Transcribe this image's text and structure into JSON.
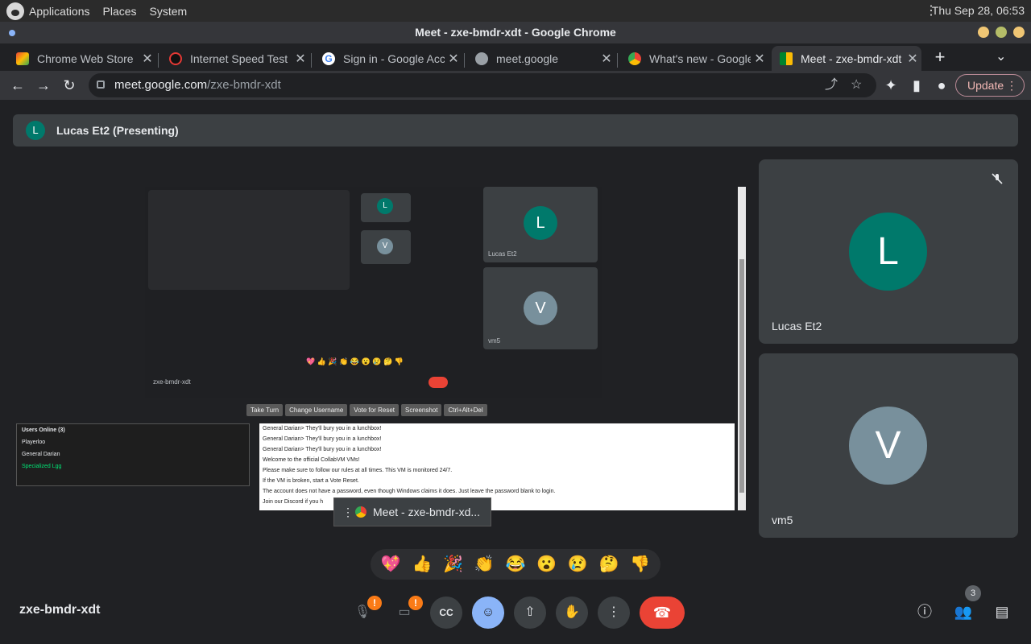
{
  "desktop": {
    "menus": [
      "Applications",
      "Places",
      "System"
    ],
    "clock": "Thu Sep 28, 06:53"
  },
  "window": {
    "title": "Meet - zxe-bmdr-xdt - Google Chrome"
  },
  "tabs": [
    {
      "label": "Chrome Web Store",
      "icon": "chrome-web-store-icon"
    },
    {
      "label": "Internet Speed Test | F",
      "icon": "speedtest-icon"
    },
    {
      "label": "Sign in - Google Accou",
      "icon": "google-icon"
    },
    {
      "label": "meet.google",
      "icon": "globe-icon"
    },
    {
      "label": "What's new - Google",
      "icon": "chrome-icon"
    },
    {
      "label": "Meet - zxe-bmdr-xdt",
      "icon": "google-meet-icon",
      "active": true
    }
  ],
  "toolbar": {
    "url_host": "meet.google.com",
    "url_path": "/zxe-bmdr-xdt",
    "update_label": "Update"
  },
  "meet": {
    "presenter_initial": "L",
    "presenting_text": "Lucas Et2 (Presenting)",
    "meeting_code": "zxe-bmdr-xdt",
    "popup_chip": "Meet - zxe-bmdr-xd...",
    "participants": [
      {
        "initial": "L",
        "name": "Lucas Et2",
        "color": "#00796b",
        "muted": true
      },
      {
        "initial": "V",
        "name": "vm5",
        "color": "#78909c"
      }
    ],
    "reactions": [
      "💖",
      "👍",
      "🎉",
      "👏",
      "😂",
      "😮",
      "😢",
      "🤔",
      "👎"
    ],
    "people_count": "3",
    "controls": {
      "mic_badge": "!",
      "cam_badge": "!",
      "captions_label": "CC"
    }
  },
  "shared_screen": {
    "inner_meeting_code": "zxe-bmdr-xdt",
    "inner_tiles": [
      {
        "initial": "L",
        "name": "Lucas Et2"
      },
      {
        "initial": "V",
        "name": "vm5"
      }
    ],
    "vm_buttons": [
      "Take Turn",
      "Change Username",
      "Vote for Reset",
      "Screenshot",
      "Ctrl+Alt+Del"
    ],
    "users_header": "Users Online (3)",
    "users": [
      "Playerloo",
      "General Darian",
      "Specialized Lgg"
    ],
    "chat": [
      "General Darian> They'll bury you in a lunchbox!",
      "General Darian> They'll bury you in a lunchbox!",
      "General Darian> They'll bury you in a lunchbox!",
      "Welcome to the official CollabVM VMs!",
      "Please make sure to follow our rules at all times. This VM is monitored 24/7.",
      "If the VM is broken, start a Vote Reset.",
      "The account does not have a password, even though Windows claims it does. Just leave the password blank to login.",
      "Join our Discord if you h"
    ]
  }
}
